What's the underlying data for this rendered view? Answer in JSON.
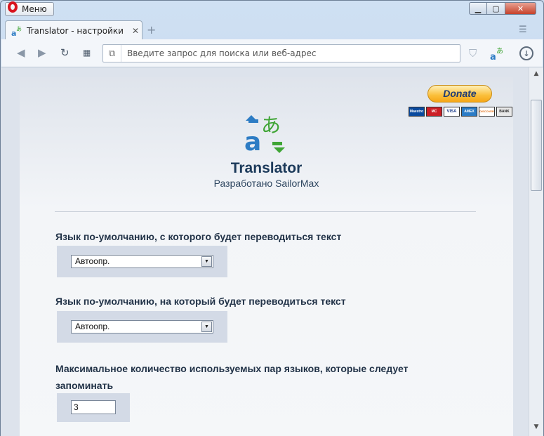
{
  "browser": {
    "menu_label": "Меню",
    "tab_title": "Translator - настройки",
    "tab_close": "✕",
    "new_tab": "+",
    "address_placeholder": "Введите запрос для поиска или веб-адрес"
  },
  "page": {
    "donate_label": "Donate",
    "cards": [
      "Maestro",
      "MC",
      "VISA",
      "AMEX",
      "DISCOVER",
      "BANK"
    ],
    "app_title": "Translator",
    "app_subtitle": "Разработано SailorMax",
    "settings": [
      {
        "label": "Язык по-умолчанию, с которого будет переводиться текст",
        "value": "Автоопр."
      },
      {
        "label": "Язык по-умолчанию, на который будет переводиться текст",
        "value": "Автоопр."
      },
      {
        "label": "Максимальное количество используемых пар языков, которые следует запоминать",
        "value": "3"
      }
    ]
  },
  "colors": {
    "accent": "#1c3a5a",
    "donate": "#fbbf3a",
    "logo_blue": "#2d7cc4",
    "logo_green": "#3fa535"
  }
}
